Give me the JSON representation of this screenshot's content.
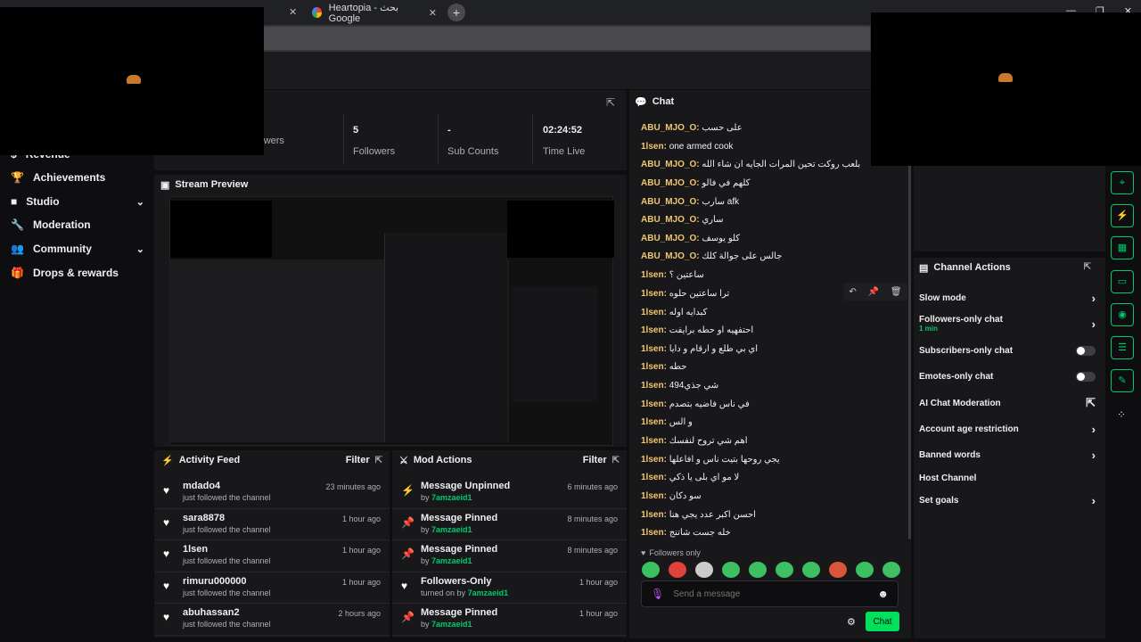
{
  "browser": {
    "tab_title": "Heartopia - بحث Google",
    "tab_close": "✕",
    "new_tab": "+",
    "window_controls": [
      "—",
      "❐",
      "✕"
    ]
  },
  "sidebar": {
    "items": [
      {
        "label": "Revenue",
        "icon": "dollar-icon",
        "glyph": "$"
      },
      {
        "label": "Achievements",
        "icon": "trophy-icon",
        "glyph": "🏆"
      },
      {
        "label": "Studio",
        "icon": "video-icon",
        "glyph": "■",
        "chevron": "⌄"
      },
      {
        "label": "Moderation",
        "icon": "wrench-icon",
        "glyph": "🔧"
      },
      {
        "label": "Community",
        "icon": "people-icon",
        "glyph": "👥",
        "chevron": "⌄"
      },
      {
        "label": "Drops & rewards",
        "icon": "gift-icon",
        "glyph": "🎁"
      }
    ]
  },
  "stats": [
    {
      "value": "",
      "label": "Viewers"
    },
    {
      "value": "5",
      "label": "Followers"
    },
    {
      "value": "-",
      "label": "Sub Counts"
    },
    {
      "value": "02:24:52",
      "label": "Time Live"
    }
  ],
  "preview": {
    "title": "Stream Preview"
  },
  "activity_feed": {
    "title": "Activity Feed",
    "filter": "Filter",
    "items": [
      {
        "name": "mdado4",
        "sub": "just followed the channel",
        "time": "23 minutes ago"
      },
      {
        "name": "sara8878",
        "sub": "just followed the channel",
        "time": "1 hour ago"
      },
      {
        "name": "1lsen",
        "sub": "just followed the channel",
        "time": "1 hour ago"
      },
      {
        "name": "rimuru000000",
        "sub": "just followed the channel",
        "time": "1 hour ago"
      },
      {
        "name": "abuhassan2",
        "sub": "just followed the channel",
        "time": "2 hours ago"
      }
    ]
  },
  "mod_actions": {
    "title": "Mod Actions",
    "filter": "Filter",
    "items": [
      {
        "name": "Message Unpinned",
        "prefix": "by",
        "user": "7amzaeid1",
        "time": "6 minutes ago",
        "icon": "unpin-icon",
        "glyph": "⚡"
      },
      {
        "name": "Message Pinned",
        "prefix": "by",
        "user": "7amzaeid1",
        "time": "8 minutes ago",
        "icon": "pin-icon",
        "glyph": "📌"
      },
      {
        "name": "Message Pinned",
        "prefix": "by",
        "user": "7amzaeid1",
        "time": "8 minutes ago",
        "icon": "pin-icon",
        "glyph": "📌"
      },
      {
        "name": "Followers-Only",
        "prefix": "turned on by",
        "user": "7amzaeid1",
        "time": "1 hour ago",
        "icon": "heart-icon",
        "glyph": "♥"
      },
      {
        "name": "Message Pinned",
        "prefix": "by",
        "user": "7amzaeid1",
        "time": "1 hour ago",
        "icon": "pin-icon",
        "glyph": "📌"
      }
    ]
  },
  "chat": {
    "title": "Chat",
    "messages": [
      {
        "user": "ABU_MJO_O:",
        "text": "على حسب"
      },
      {
        "user": "1lsen:",
        "text": "one armed cook"
      },
      {
        "user": "ABU_MJO_O:",
        "text": "بلعب روكت تحين المرات الجايه ان شاء الله"
      },
      {
        "user": "ABU_MJO_O:",
        "text": "كلهم في فالو"
      },
      {
        "user": "ABU_MJO_O:",
        "text": "سارب afk"
      },
      {
        "user": "ABU_MJO_O:",
        "text": "ساري"
      },
      {
        "user": "ABU_MJO_O:",
        "text": "كلو يوسف"
      },
      {
        "user": "ABU_MJO_O:",
        "text": "جالس على جوالة كلك"
      },
      {
        "user": "1lsen:",
        "text": "ساعتين ؟"
      },
      {
        "user": "1lsen:",
        "text": "ترا ساعتين حلوه"
      },
      {
        "user": "1lsen:",
        "text": "كبدايه اوله"
      },
      {
        "user": "1lsen:",
        "text": "احتفهيه او حطه برايفت"
      },
      {
        "user": "1lsen:",
        "text": "اي بي طلع و ارقام و دايا"
      },
      {
        "user": "1lsen:",
        "text": "حطه"
      },
      {
        "user": "1lsen:",
        "text": "شي جذي494"
      },
      {
        "user": "1lsen:",
        "text": "في ناس فاضيه بتصدم"
      },
      {
        "user": "1lsen:",
        "text": "و الس"
      },
      {
        "user": "1lsen:",
        "text": "اهم شي تروح لنفسك"
      },
      {
        "user": "1lsen:",
        "text": "يجي روحها بتيت ناس و افاعلها"
      },
      {
        "user": "1lsen:",
        "text": "لا مو اي بلى يا ذكي"
      },
      {
        "user": "1lsen:",
        "text": "سو دكان"
      },
      {
        "user": "1lsen:",
        "text": "احسن اكبر عدد يجي هنا"
      },
      {
        "user": "1lsen:",
        "text": "خله جست شاتنج"
      }
    ],
    "followers_only": "Followers only",
    "placeholder": "Send a message",
    "send_label": "Chat"
  },
  "channel_actions": {
    "title": "Channel Actions",
    "items": [
      {
        "label": "Slow mode",
        "type": "chevron"
      },
      {
        "label": "Followers-only chat",
        "sub": "1 min",
        "type": "chevron"
      },
      {
        "label": "Subscribers-only chat",
        "type": "toggle"
      },
      {
        "label": "Emotes-only chat",
        "type": "toggle"
      },
      {
        "label": "AI Chat Moderation",
        "type": "external"
      },
      {
        "label": "Account age restriction",
        "type": "chevron"
      },
      {
        "label": "Banned words",
        "type": "chevron"
      },
      {
        "label": "Host Channel",
        "type": "none"
      },
      {
        "label": "Set goals",
        "type": "chevron"
      }
    ]
  },
  "colors": {
    "accent": "#00c96d",
    "username": "#f0c66e",
    "send": "#00e05a"
  }
}
